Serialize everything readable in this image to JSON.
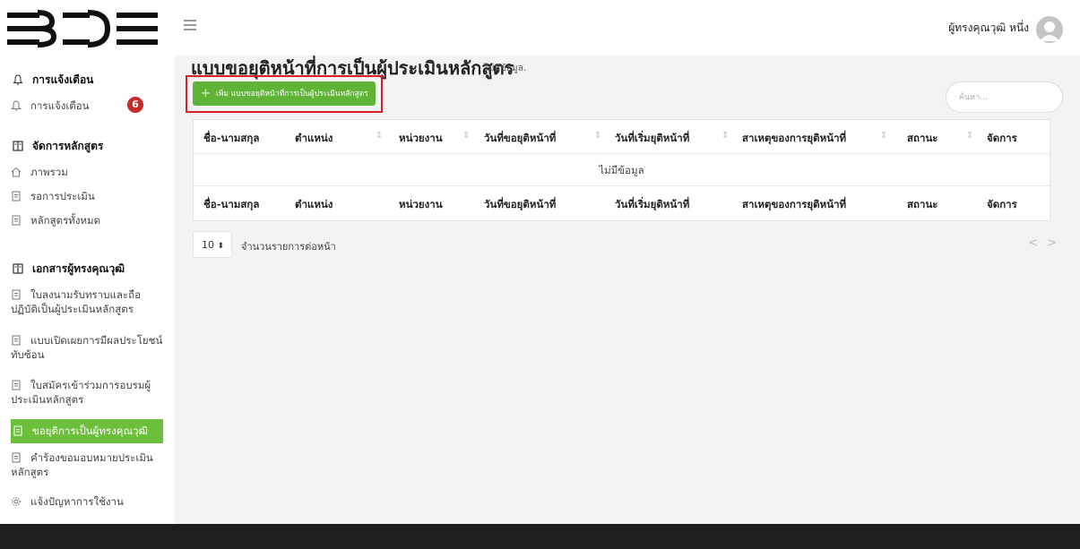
{
  "header": {
    "logo_text": "BDE",
    "user_name": "ผู้ทรงคุณวุฒิ หนึ่ง"
  },
  "sidebar": {
    "sections": [
      {
        "title": "การแจ้งเตือน",
        "icon": "bell-icon"
      },
      {
        "title": "จัดการหลักสูตร",
        "icon": "book-icon"
      },
      {
        "title": "เอกสารผู้ทรงคุณวุฒิ",
        "icon": "book-icon"
      }
    ],
    "items": [
      {
        "label": "การแจ้งเตือน",
        "icon": "bell-icon",
        "badge": "6"
      },
      {
        "label": "ภาพรวม",
        "icon": "home-icon"
      },
      {
        "label": "รอการประเมิน",
        "icon": "document-icon"
      },
      {
        "label": "หลักสูตรทั้งหมด",
        "icon": "document-icon"
      },
      {
        "label": "ใบลงนามรับทราบและถือปฏิบัติเป็นผู้ประเมินหลักสูตร",
        "icon": "document-icon"
      },
      {
        "label": "แบบเปิดเผยการมีผลประโยชน์ทับซ้อน",
        "icon": "document-icon"
      },
      {
        "label": "ใบสมัครเข้าร่วมการอบรมผู้ประเมินหลักสูตร",
        "icon": "document-icon"
      },
      {
        "label": "ขอยุติการเป็นผู้ทรงคุณวุฒิ",
        "icon": "document-icon",
        "active": true
      },
      {
        "label": "คำร้องขอมอบหมายประเมินหลักสูตร",
        "icon": "document-icon"
      },
      {
        "label": "แจ้งปัญหาการใช้งาน",
        "icon": "gear-icon"
      }
    ]
  },
  "main": {
    "title": "แบบขอยุติหน้าที่การเป็นผู้ประเมินหลักสูตร",
    "subtitle": "ไม่มีข้อมูล.",
    "add_button": "เพิ่ม แบบขอยุติหน้าที่การเป็นผู้ประเมินหลักสูตร",
    "search_placeholder": "ค้นหา...",
    "columns": [
      "ชื่อ-นามสกุล",
      "ตำแหน่ง",
      "หน่วยงาน",
      "วันที่ขอยุติหน้าที่",
      "วันที่เริ่มยุติหน้าที่",
      "สาเหตุของการยุติหน้าที่",
      "สถานะ",
      "จัดการ"
    ],
    "empty_text": "ไม่มีข้อมูล",
    "page_size": "10",
    "per_page_label": "จำนวนรายการต่อหน้า",
    "pager_prev": "<",
    "pager_next": ">"
  },
  "colors": {
    "accent_green": "#5fb336",
    "sidebar_active": "#6bbf3b",
    "badge_red": "#c42b2b",
    "highlight_red": "#d8232a",
    "footer": "#1e1e1e"
  }
}
